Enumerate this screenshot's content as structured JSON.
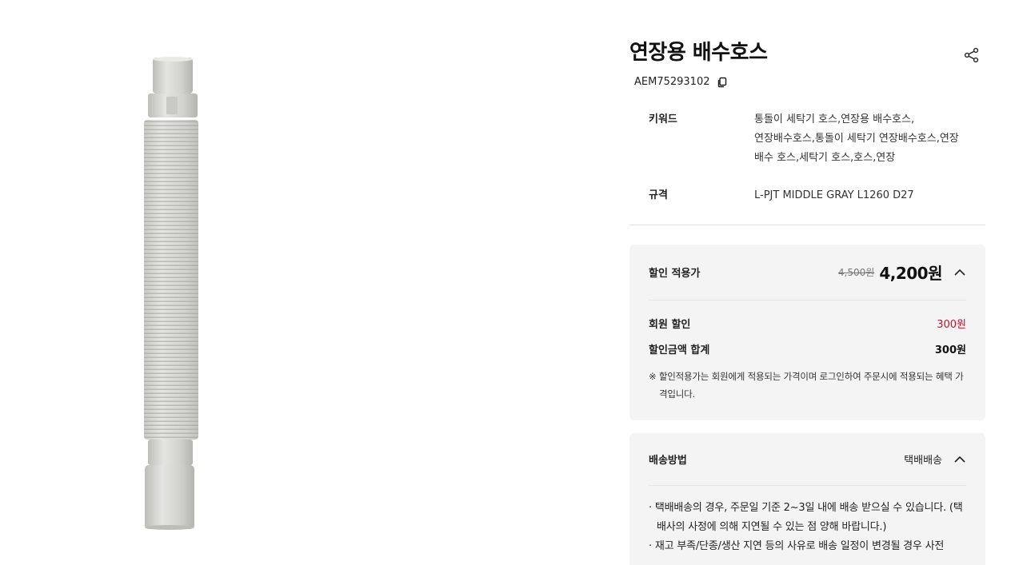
{
  "product": {
    "title": "연장용 배수호스",
    "code": "AEM75293102"
  },
  "spec": {
    "keyword_label": "키워드",
    "keyword_value": "통돌이 세탁기 호스,연장용 배수호스,연장배수호스,통돌이 세탁기 연장배수호스,연장 배수 호스,세탁기 호스,호스,연장",
    "size_label": "규격",
    "size_value": "L-PJT MIDDLE GRAY L1260 D27"
  },
  "price": {
    "label": "할인 적용가",
    "original": "4,500원",
    "sale": "4,200원",
    "member_label": "회원 할인",
    "member_value": "300원",
    "total_label": "할인금액 합계",
    "total_value": "300원",
    "notice": "※ 할인적용가는 회원에게 적용되는 가격이며 로그인하여 주문시에 적용되는 혜택 가격입니다."
  },
  "shipping": {
    "label": "배송방법",
    "value": "택배배송",
    "line1": "· 택배배송의 경우, 주문일 기준 2~3일 내에 배송 받으실 수 있습니다. (택배사의 사정에 의해 지연될 수 있는 점 양해 바랍니다.)",
    "line2": "· 재고 부족/단종/생산 지연 등의 사유로 배송 일정이 변경될 경우 사전"
  },
  "icons": {
    "share": "share-icon",
    "copy": "copy-icon",
    "price_toggle": "chevron-up-icon",
    "shipping_toggle": "chevron-up-icon"
  },
  "colors": {
    "discount_red": "#c8102e",
    "panel_bg": "#f4f4f4",
    "hose_gray": "#d3d3cf"
  }
}
